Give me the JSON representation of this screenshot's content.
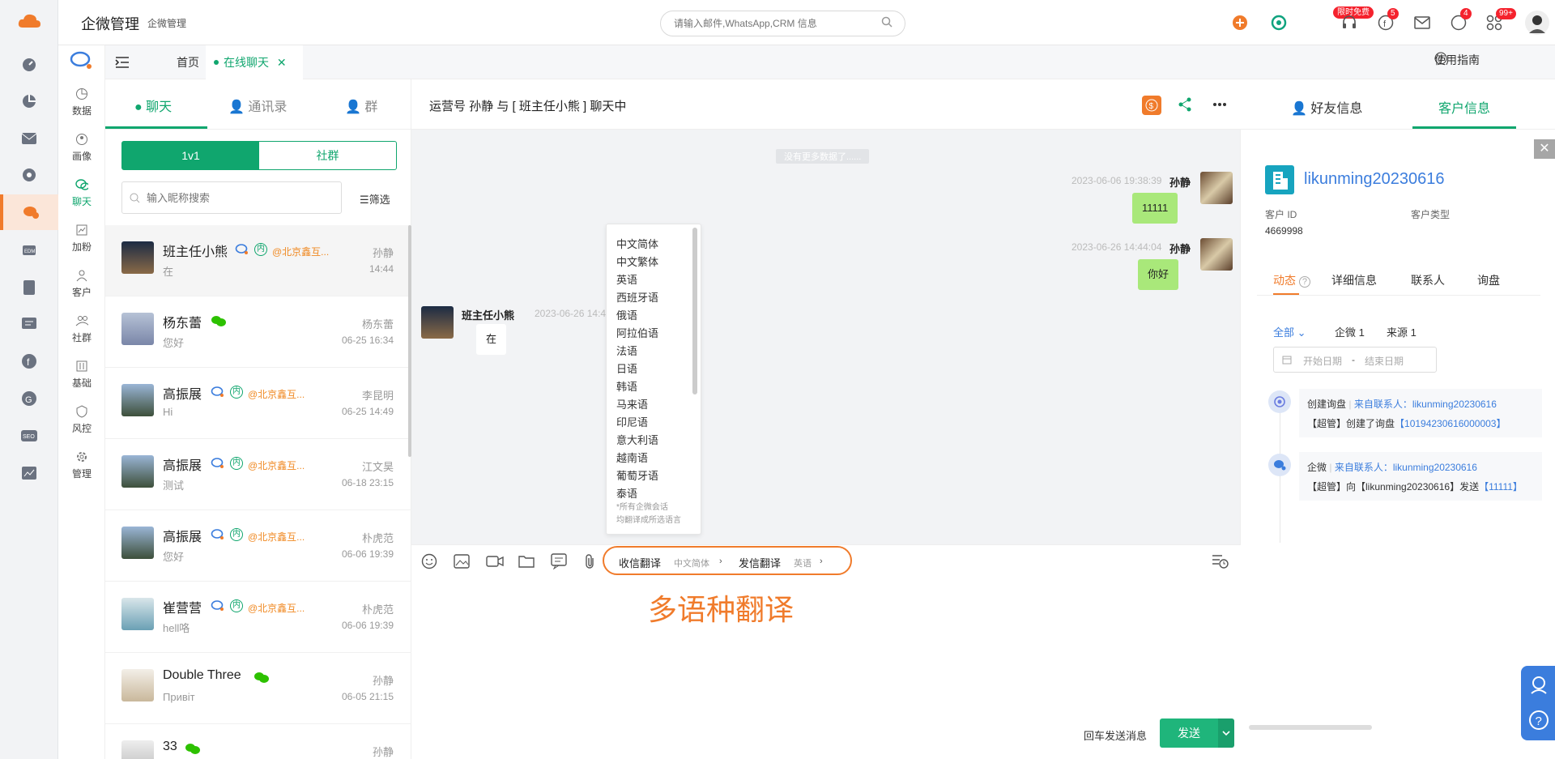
{
  "header": {
    "title": "企微管理",
    "subtitle": "企微管理",
    "search_placeholder": "请输入邮件,WhatsApp,CRM 信息",
    "promo": "限时免费",
    "badge_facebook": "5",
    "badge_whatsapp": "4",
    "badge_apps": "99+",
    "guide": "使用指南"
  },
  "nav2": {
    "items": [
      "数据",
      "画像",
      "聊天",
      "加粉",
      "客户",
      "社群",
      "基础",
      "风控",
      "管理"
    ]
  },
  "tabs": {
    "home": "首页",
    "online_chat": "在线聊天"
  },
  "contacts": {
    "tab_chat": "聊天",
    "tab_addr": "通讯录",
    "tab_group": "群",
    "seg_1v1": "1v1",
    "seg_group": "社群",
    "search_placeholder": "输入昵称搜索",
    "filter": "筛选",
    "rows": [
      {
        "name": "班主任小熊",
        "msg": "在",
        "owner": "孙静",
        "time": "14:44",
        "org": "@北京鑫互..."
      },
      {
        "name": "杨东蕾",
        "msg": "您好",
        "owner": "杨东蕾",
        "time": "06-25 16:34",
        "org": ""
      },
      {
        "name": "高振展",
        "msg": "Hi",
        "owner": "李昆明",
        "time": "06-25 14:49",
        "org": "@北京鑫互..."
      },
      {
        "name": "高振展",
        "msg": "测试",
        "owner": "江文昊",
        "time": "06-18 23:15",
        "org": "@北京鑫互..."
      },
      {
        "name": "高振展",
        "msg": "您好",
        "owner": "朴虎范",
        "time": "06-06 19:39",
        "org": "@北京鑫互..."
      },
      {
        "name": "崔营营",
        "msg": "hell咯",
        "owner": "朴虎范",
        "time": "06-06 19:39",
        "org": "@北京鑫互..."
      },
      {
        "name": "Double Three",
        "msg": "Привіт",
        "owner": "孙静",
        "time": "06-05 21:15",
        "org": ""
      },
      {
        "name": "33",
        "msg": "",
        "owner": "孙静",
        "time": "",
        "org": ""
      }
    ],
    "chip_in": "内"
  },
  "chat": {
    "title": "运营号 孙静 与 [ 班主任小熊 ] 聊天中",
    "no_more": "没有更多数据了......",
    "msg1": {
      "time": "2023-06-06 19:38:39",
      "name": "孙静",
      "text": "11111"
    },
    "msg2": {
      "time": "2023-06-26 14:44:04",
      "name": "孙静",
      "text": "你好"
    },
    "msg3": {
      "time": "2023-06-26 14:44",
      "name": "班主任小熊",
      "text": "在"
    },
    "languages": [
      "中文简体",
      "中文繁体",
      "英语",
      "西班牙语",
      "俄语",
      "阿拉伯语",
      "法语",
      "日语",
      "韩语",
      "马来语",
      "印尼语",
      "意大利语",
      "越南语",
      "葡萄牙语",
      "泰语"
    ],
    "lang_note1": "*所有企微会话",
    "lang_note2": "均翻译成所选语言",
    "recv_label": "收信翻译",
    "recv_value": "中文简体",
    "send_label": "发信翻译",
    "send_value": "英语",
    "caption": "多语种翻译",
    "enter_send": "回车发送消息",
    "send_button": "发送"
  },
  "right": {
    "tab_friend": "好友信息",
    "tab_customer": "客户信息",
    "customer_name": "likunming20230616",
    "id_label": "客户 ID",
    "id_value": "4669998",
    "type_label": "客户类型",
    "dtabs": [
      "动态",
      "详细信息",
      "联系人",
      "询盘"
    ],
    "filters": [
      "全部",
      "企微 1",
      "来源 1"
    ],
    "start_date": "开始日期",
    "end_date": "结束日期",
    "date_sep": "-",
    "tl1": {
      "type": "创建询盘",
      "from": "来自联系人：",
      "contact": "likunming20230616",
      "line2a": "【超管】创建了询盘",
      "line2b": "【10194230616000003】"
    },
    "tl2": {
      "type": "企微",
      "from": "来自联系人：",
      "contact": "likunming20230616",
      "line2a": "【超管】向【likunming20230616】发送",
      "line2b": "【11111】"
    }
  }
}
